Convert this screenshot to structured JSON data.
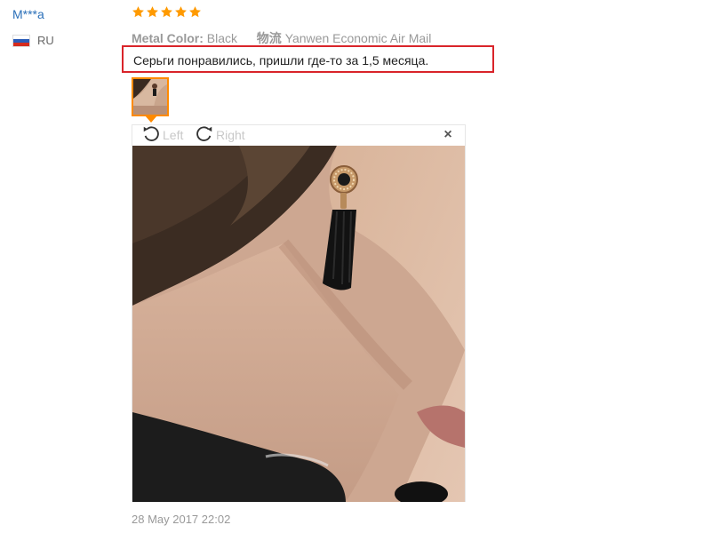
{
  "reviewer": {
    "name": "M***a",
    "country_code": "RU",
    "flag_colors": [
      "#ffffff",
      "#2b5cb8",
      "#d52b1e"
    ]
  },
  "rating": {
    "stars": 5,
    "max": 5,
    "color": "#ff9a00"
  },
  "attributes": {
    "color_label": "Metal Color:",
    "color_value": "Black",
    "shipping_label": "物流",
    "shipping_value": "Yanwen Economic Air Mail"
  },
  "review": {
    "text": "Серьги понравились, пришли где-то за 1,5 месяца.",
    "highlight_color": "#d9242a"
  },
  "viewer": {
    "rotate_left_label": "Left",
    "rotate_right_label": "Right",
    "close_label": "×",
    "icons": [
      "rotate-left-icon",
      "rotate-right-icon",
      "close-icon"
    ]
  },
  "date": "28 May 2017 22:02"
}
